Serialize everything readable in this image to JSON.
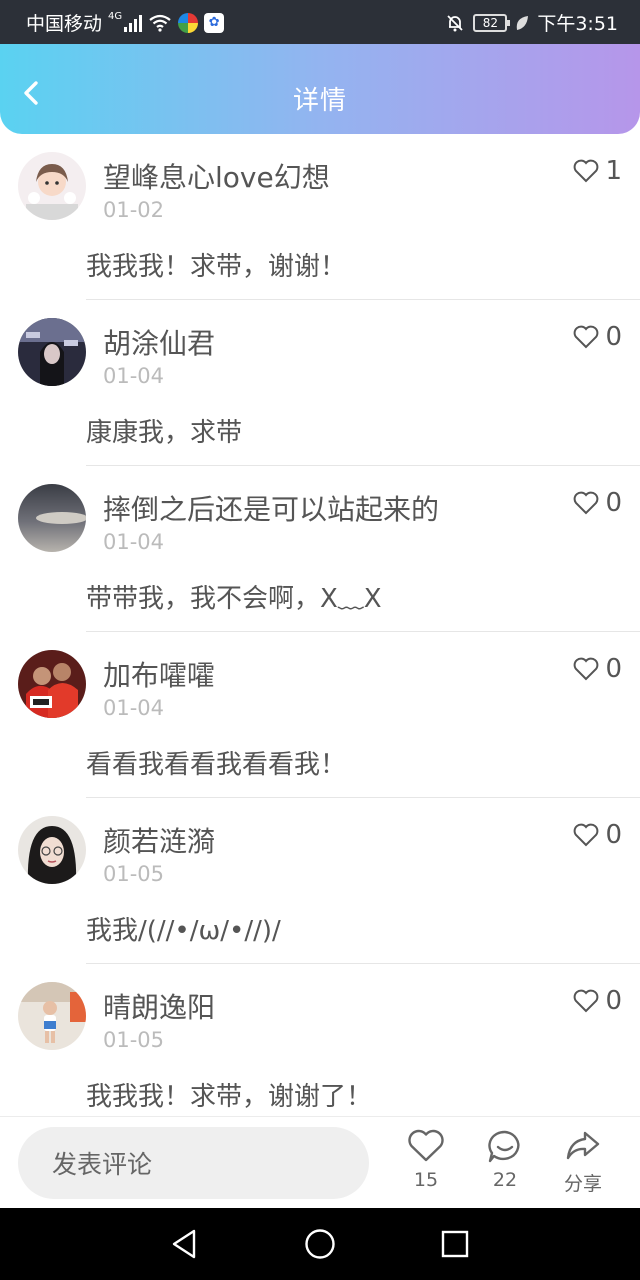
{
  "status_bar": {
    "carrier": "中国移动",
    "network": "4G",
    "battery": "82",
    "time": "下午3:51",
    "icons": [
      "signal-icon",
      "wifi-icon",
      "colorful-app-icon",
      "baidu-app-icon",
      "mute-bell-icon",
      "battery-icon",
      "leaf-icon"
    ]
  },
  "header": {
    "title": "详情",
    "back_icon": "chevron-left-icon"
  },
  "comments": [
    {
      "user": "望峰息心love幻想",
      "date": "01-02",
      "likes": "1",
      "text": "我我我！求带，谢谢！"
    },
    {
      "user": "胡涂仙君",
      "date": "01-04",
      "likes": "0",
      "text": "康康我，求带"
    },
    {
      "user": "摔倒之后还是可以站起来的",
      "date": "01-04",
      "likes": "0",
      "text": "带带我，我不会啊，X﹏X"
    },
    {
      "user": "加布嚯嚯",
      "date": "01-04",
      "likes": "0",
      "text": "看看我看看我看看我！"
    },
    {
      "user": "颜若涟漪",
      "date": "01-05",
      "likes": "0",
      "text": "我我/(//•/ω/•//)/"
    },
    {
      "user": "晴朗逸阳",
      "date": "01-05",
      "likes": "0",
      "text": "我我我！求带，谢谢了！"
    }
  ],
  "bottom_bar": {
    "comment_placeholder": "发表评论",
    "like_count": "15",
    "comment_count": "22",
    "share_label": "分享"
  },
  "colors": {
    "header_gradient_start": "#5ad2f1",
    "header_gradient_end": "#b696ea",
    "status_bar": "#2c3038"
  }
}
